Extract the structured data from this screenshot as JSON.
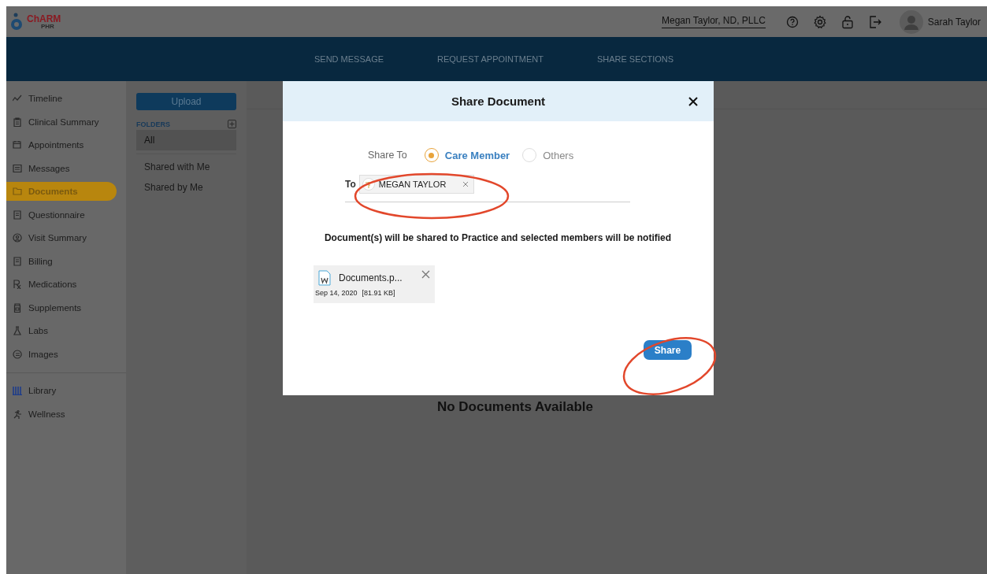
{
  "header": {
    "logo": {
      "name": "ChARM",
      "sub": "PHR"
    },
    "practice": "Megan Taylor, ND, PLLC",
    "user": "Sarah Taylor"
  },
  "nav": [
    "SEND MESSAGE",
    "REQUEST APPOINTMENT",
    "SHARE SECTIONS"
  ],
  "sidebar": {
    "items": [
      {
        "label": "Timeline",
        "selected": false
      },
      {
        "label": "Clinical Summary",
        "selected": false
      },
      {
        "label": "Appointments",
        "selected": false
      },
      {
        "label": "Messages",
        "selected": false
      },
      {
        "label": "Documents",
        "selected": true
      },
      {
        "label": "Questionnaire",
        "selected": false
      },
      {
        "label": "Visit Summary",
        "selected": false
      },
      {
        "label": "Billing",
        "selected": false
      },
      {
        "label": "Medications",
        "selected": false
      },
      {
        "label": "Supplements",
        "selected": false
      },
      {
        "label": "Labs",
        "selected": false
      },
      {
        "label": "Images",
        "selected": false
      }
    ],
    "bottom_items": [
      {
        "label": "Library",
        "selected": false
      },
      {
        "label": "Wellness",
        "selected": false
      }
    ]
  },
  "folders": {
    "upload": "Upload",
    "heading": "FOLDERS",
    "items": [
      {
        "label": "All",
        "selected": true
      }
    ],
    "shared": [
      {
        "label": "Shared with Me",
        "selected": false
      },
      {
        "label": "Shared by Me",
        "selected": false
      }
    ]
  },
  "empty_message": "No Documents Available",
  "dialog": {
    "title": "Share Document",
    "share_to_label": "Share To",
    "options": [
      {
        "label": "Care Member",
        "selected": true
      },
      {
        "label": "Others",
        "selected": false
      }
    ],
    "to_label": "To",
    "recipients": [
      {
        "name": "MEGAN TAYLOR"
      }
    ],
    "note": "Document(s) will be shared to Practice and selected members will be notified",
    "files": [
      {
        "name": "Documents.p...",
        "date": "Sep 14, 2020",
        "size": "[81.91 KB]"
      }
    ],
    "button": "Share"
  }
}
